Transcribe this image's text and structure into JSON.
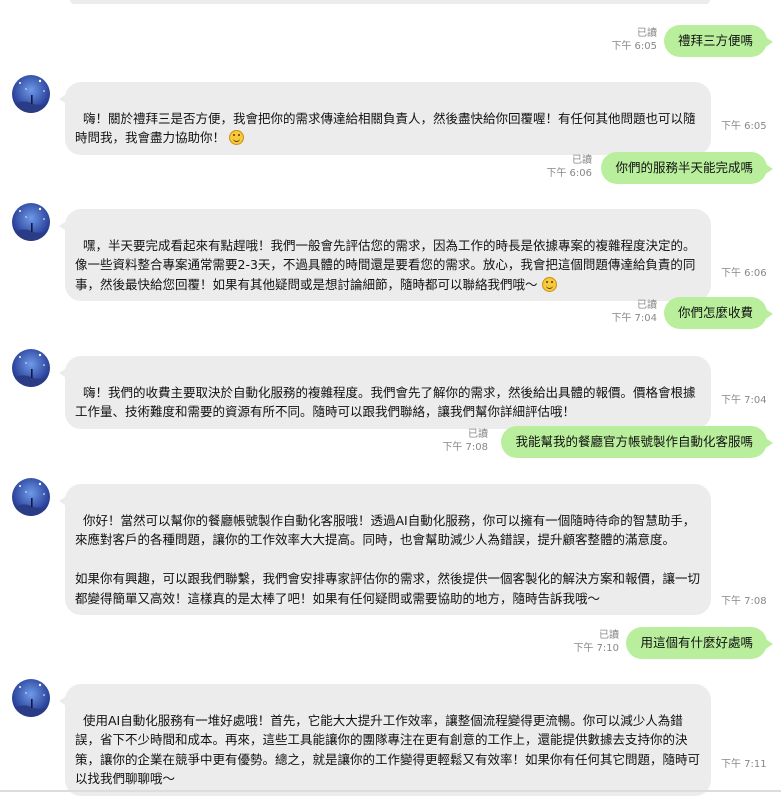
{
  "status": {
    "read": "已讀"
  },
  "messages": [
    {
      "dir": "out",
      "text": "禮拜三方便嗎",
      "time": "下午 6:05"
    },
    {
      "dir": "in",
      "text": "嗨！關於禮拜三是否方便，我會把你的需求傳達給相關負責人，然後盡快給你回覆喔！有任何其他問題也可以隨時問我，我會盡力協助你！",
      "time": "下午 6:05"
    },
    {
      "dir": "out",
      "text": "你們的服務半天能完成嗎",
      "time": "下午 6:06"
    },
    {
      "dir": "in",
      "text": "嘿，半天要完成看起來有點趕哦！我們一般會先評估您的需求，因為工作的時長是依據專案的複雜程度決定的。像一些資料整合專案通常需要2-3天，不過具體的時間還是要看您的需求。放心，我會把這個問題傳達給負責的同事，然後最快給您回覆！如果有其他疑問或是想討論細節，隨時都可以聯絡我們哦～",
      "time": "下午 6:06"
    },
    {
      "dir": "out",
      "text": "你們怎麼收費",
      "time": "下午 7:04"
    },
    {
      "dir": "in",
      "text": "嗨！我們的收費主要取決於自動化服務的複雜程度。我們會先了解你的需求，然後給出具體的報價。價格會根據工作量、技術難度和需要的資源有所不同。隨時可以跟我們聯絡，讓我們幫你詳細評估哦！",
      "time": "下午 7:04"
    },
    {
      "dir": "out",
      "text": "我能幫我的餐廳官方帳號製作自動化客服嗎",
      "time": "下午 7:08"
    },
    {
      "dir": "in",
      "text": "你好！當然可以幫你的餐廳帳號製作自動化客服哦！透過AI自動化服務，你可以擁有一個隨時待命的智慧助手，來應對客戶的各種問題，讓你的工作效率大大提高。同時，也會幫助減少人為錯誤，提升顧客整體的滿意度。\n\n如果你有興趣，可以跟我們聯繫，我們會安排專家評估你的需求，然後提供一個客製化的解決方案和報價，讓一切都變得簡單又高效！這樣真的是太棒了吧！如果有任何疑問或需要協助的地方，隨時告訴我哦～",
      "time": "下午 7:08"
    },
    {
      "dir": "out",
      "text": "用這個有什麼好處嗎",
      "time": "下午 7:10"
    },
    {
      "dir": "in",
      "text": "使用AI自動化服務有一堆好處哦！首先，它能大大提升工作效率，讓整個流程變得更流暢。你可以減少人為錯誤，省下不少時間和成本。再來，這些工具能讓你的團隊專注在更有創意的工作上，還能提供數據去支持你的決策，讓你的企業在競爭中更有優勢。總之，就是讓你的工作變得更輕鬆又有效率！如果你有任何其它問題，隨時可以找我們聊聊哦～",
      "time": "下午 7:11"
    }
  ],
  "icons": {
    "avatar": "starry-night-avatar",
    "emoji": "smiling-face-emoji"
  }
}
